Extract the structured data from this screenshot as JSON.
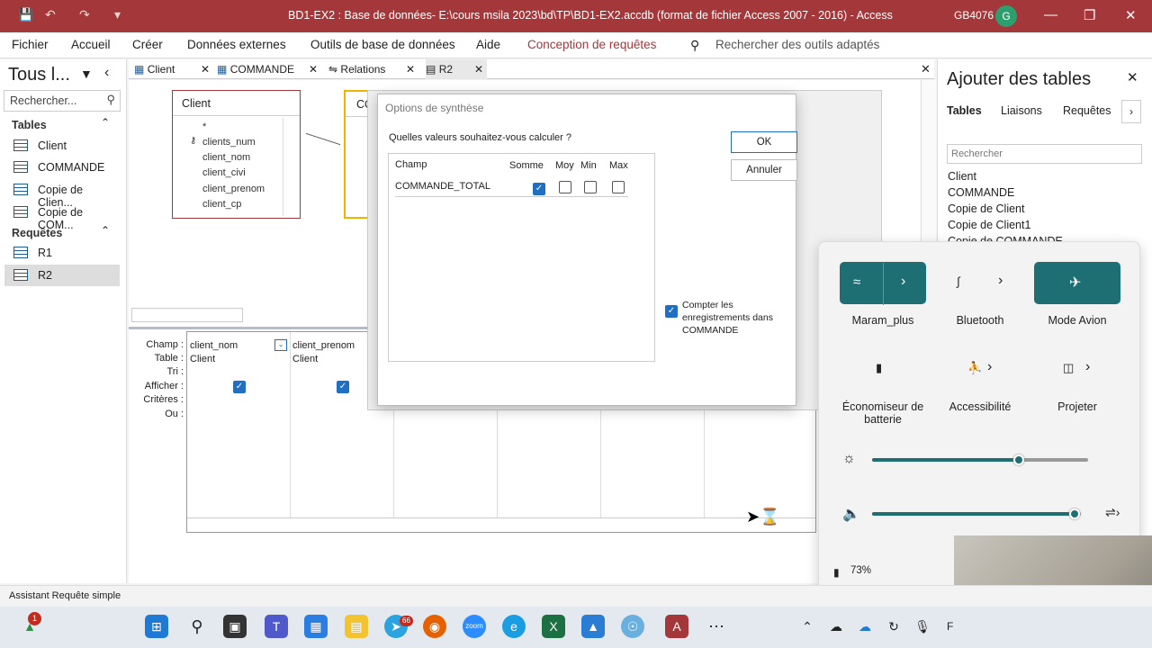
{
  "titlebar": {
    "title": "BD1-EX2 : Base de données- E:\\cours msila 2023\\bd\\TP\\BD1-EX2.accdb (format de fichier Access 2007 - 2016) - Access",
    "user": "GB4076",
    "avatar_initial": "G",
    "color": "#a4373a"
  },
  "menu": {
    "items": [
      "Fichier",
      "Accueil",
      "Créer",
      "Données externes",
      "Outils de base de données",
      "Aide",
      "Conception de requêtes"
    ],
    "search_placeholder": "Rechercher des outils adaptés"
  },
  "navpane": {
    "title": "Tous l...",
    "search_placeholder": "Rechercher...",
    "groups": [
      {
        "label": "Tables",
        "items": [
          "Client",
          "COMMANDE",
          "Copie de Clien...",
          "Copie de COM..."
        ]
      },
      {
        "label": "Requêtes",
        "items": [
          "R1",
          "R2"
        ]
      }
    ]
  },
  "doctabs": [
    "Client",
    "COMMANDE",
    "Relations",
    "R2"
  ],
  "design": {
    "table1": {
      "title": "Client",
      "fields": [
        "*",
        "clients_num",
        "client_nom",
        "client_civi",
        "client_prenom",
        "client_cp"
      ]
    },
    "table2_title": "CO"
  },
  "grid": {
    "row_labels": [
      "Champ :",
      "Table :",
      "Tri :",
      "Afficher :",
      "Critères :",
      "Ou :"
    ],
    "columns": [
      {
        "champ": "client_nom",
        "table": "Client",
        "afficher": true
      },
      {
        "champ": "client_prenom",
        "table": "Client",
        "afficher": true
      }
    ]
  },
  "dialog": {
    "title": "Options de synthèse",
    "question": "Quelles valeurs souhaitez-vous calculer ?",
    "headers": [
      "Champ",
      "Somme",
      "Moy",
      "Min",
      "Max"
    ],
    "row": {
      "field": "COMMANDE_TOTAL",
      "somme": true,
      "moy": false,
      "min": false,
      "max": false
    },
    "ok": "OK",
    "cancel": "Annuler",
    "count_label": "Compter les enregistrements dans COMMANDE",
    "count_checked": true
  },
  "addtables": {
    "title": "Ajouter des tables",
    "tabs": [
      "Tables",
      "Liaisons",
      "Requêtes"
    ],
    "search_placeholder": "Rechercher",
    "items": [
      "Client",
      "COMMANDE",
      "Copie de Client",
      "Copie de Client1",
      "Copie de COMMANDE"
    ]
  },
  "quick": {
    "accent": "#1e6f74",
    "tiles": [
      {
        "label": "Maram_plus",
        "icon": "wifi-icon",
        "on": true
      },
      {
        "label": "Bluetooth",
        "icon": "bluetooth-icon",
        "on": false
      },
      {
        "label": "Mode Avion",
        "icon": "airplane-icon",
        "on": true
      },
      {
        "label": "Économiseur de batterie",
        "icon": "battery-saver-icon",
        "on": false
      },
      {
        "label": "Accessibilité",
        "icon": "accessibility-icon",
        "on": false
      },
      {
        "label": "Projeter",
        "icon": "project-icon",
        "on": false
      }
    ],
    "brightness_level": 0.68,
    "volume_level": 0.97,
    "battery": "73%"
  },
  "status": {
    "text": "Assistant Requête simple"
  },
  "taskbar": {
    "notification_badge": "1",
    "telegram_badge": "66",
    "partial_text": "F"
  }
}
